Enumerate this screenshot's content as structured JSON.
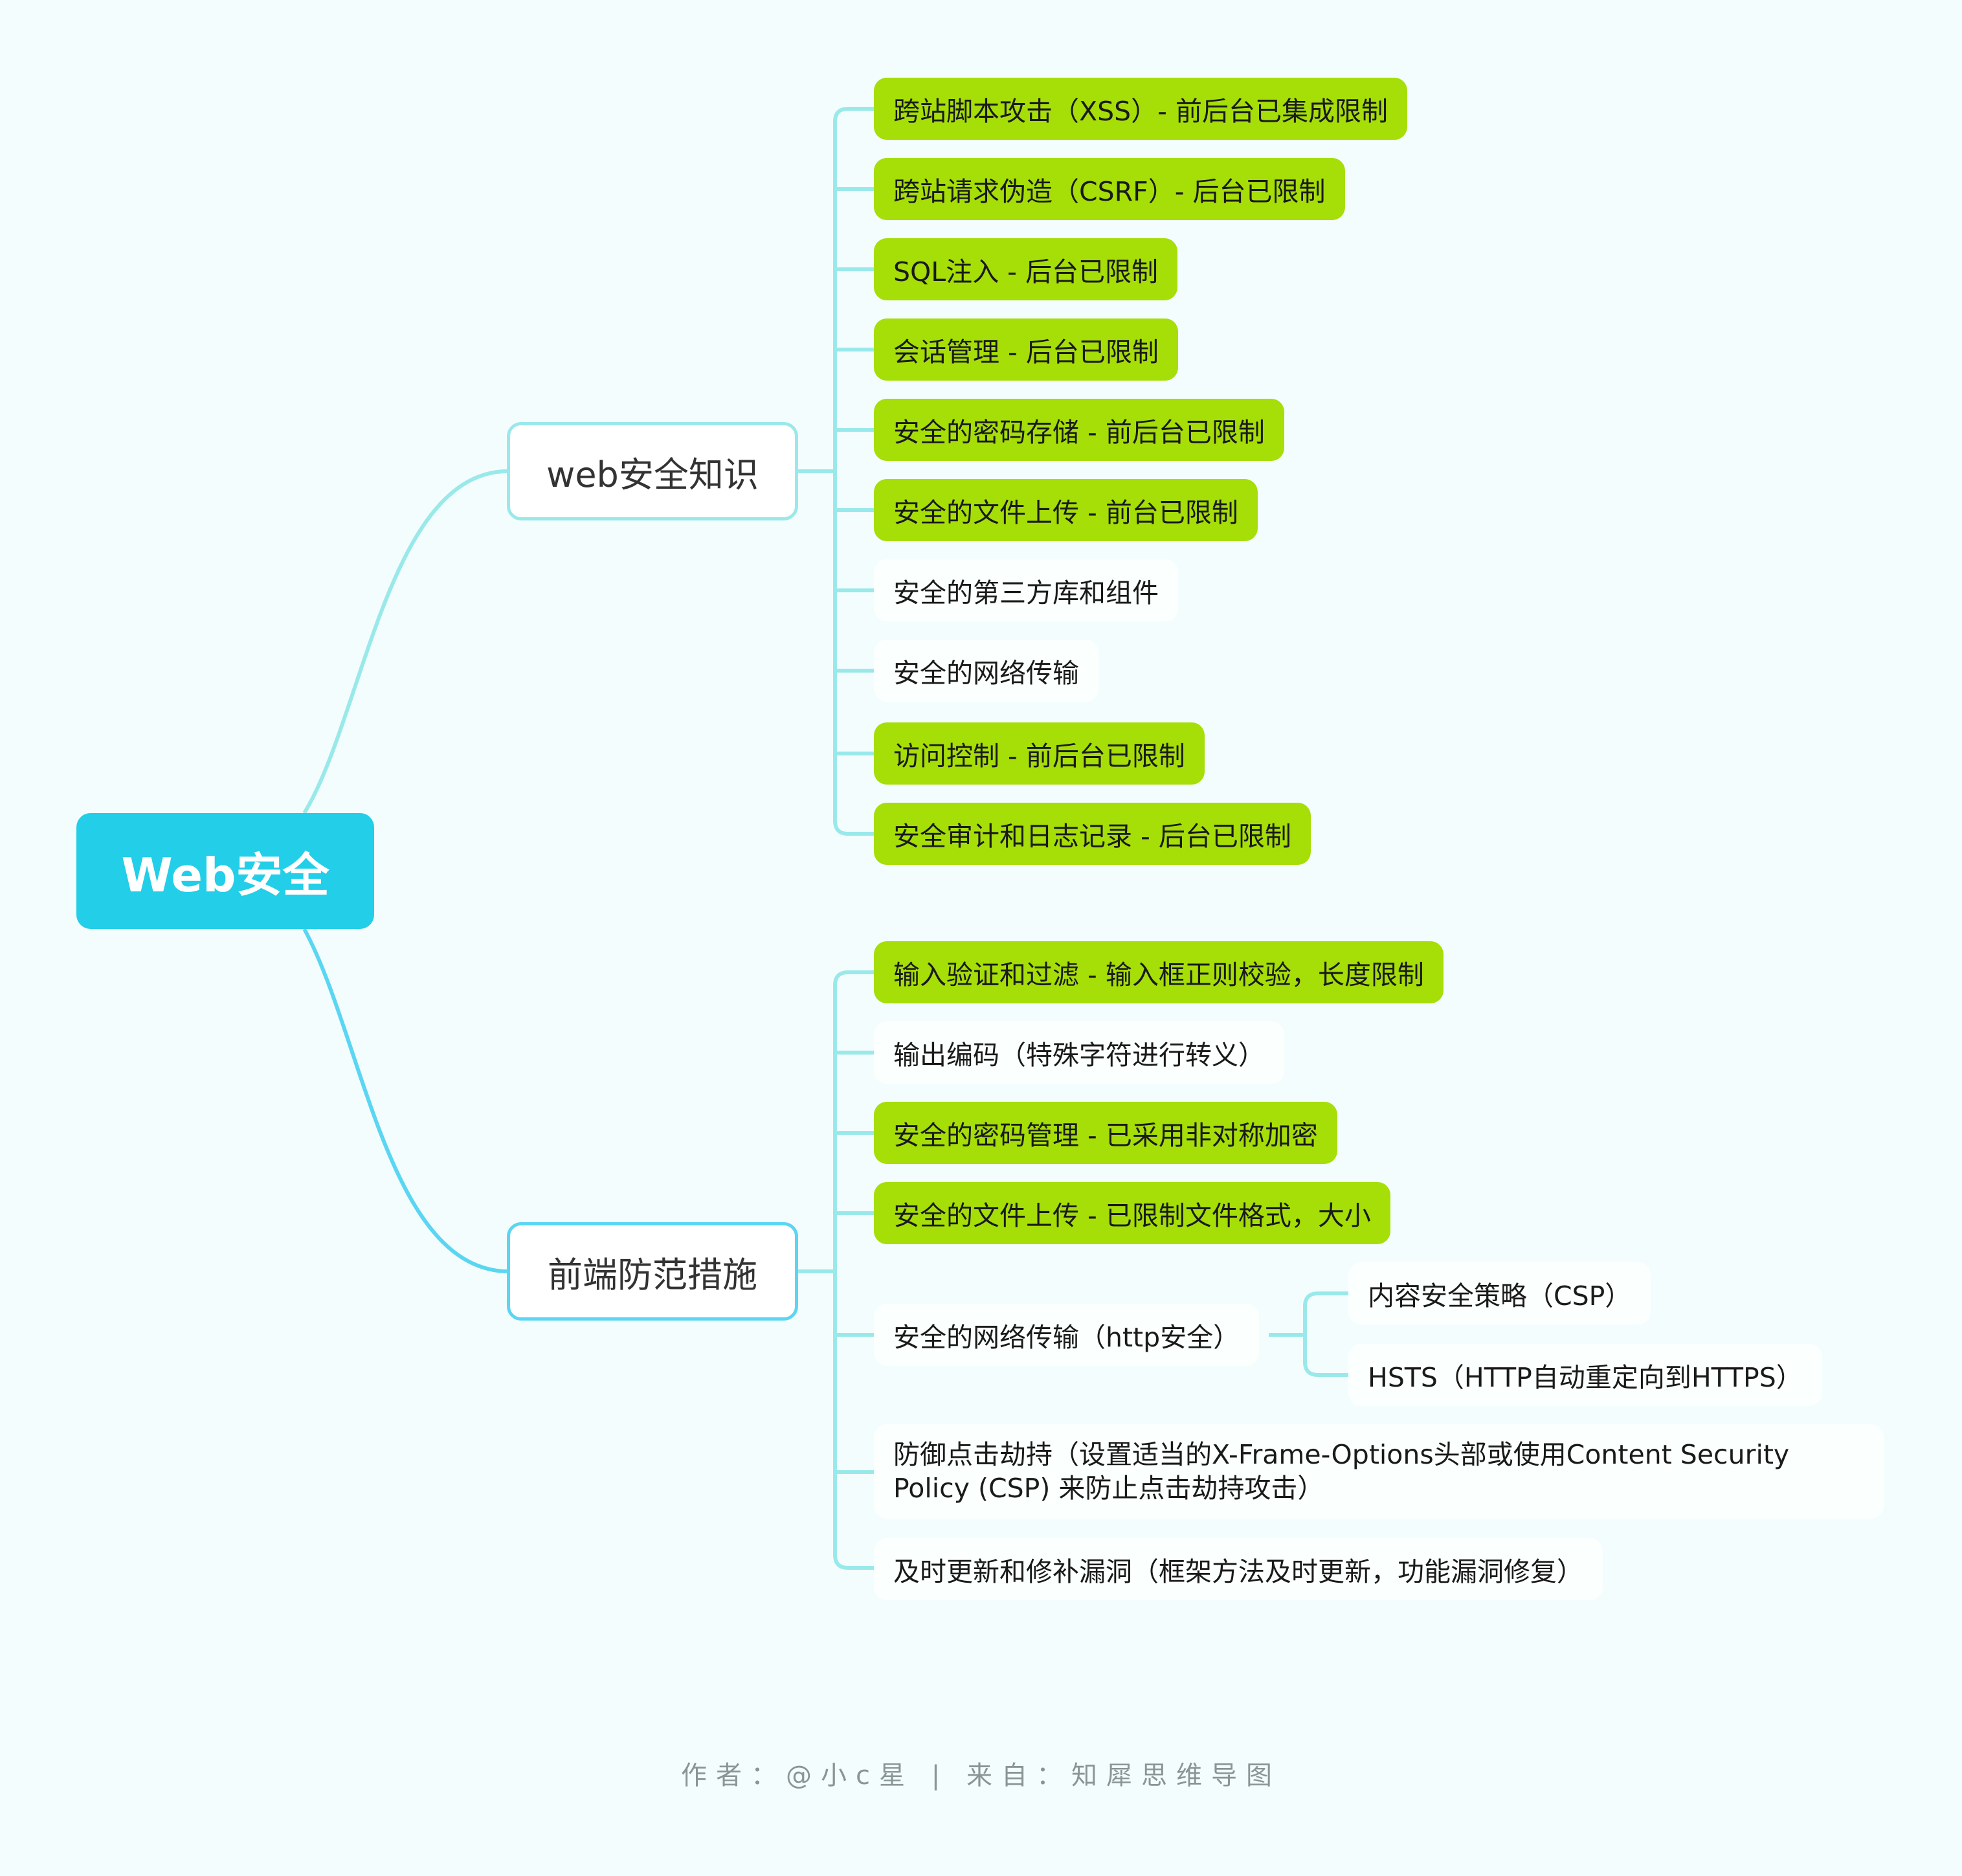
{
  "colors": {
    "background": "#f4fdfd",
    "root": "#22cee8",
    "green": "#a6de08",
    "branch1_line": "#9ae9ea",
    "branch2_line": "#5bd6f2"
  },
  "root": {
    "label": "Web安全"
  },
  "branch1": {
    "label": "web安全知识",
    "items": [
      {
        "label": "跨站脚本攻击（XSS）- 前后台已集成限制",
        "style": "green"
      },
      {
        "label": "跨站请求伪造（CSRF）- 后台已限制",
        "style": "green"
      },
      {
        "label": "SQL注入 - 后台已限制",
        "style": "green"
      },
      {
        "label": "会话管理 - 后台已限制",
        "style": "green"
      },
      {
        "label": "安全的密码存储 - 前后台已限制",
        "style": "green"
      },
      {
        "label": "安全的文件上传 - 前台已限制",
        "style": "green"
      },
      {
        "label": "安全的第三方库和组件",
        "style": "white"
      },
      {
        "label": "安全的网络传输",
        "style": "white"
      },
      {
        "label": "访问控制 - 前后台已限制",
        "style": "green"
      },
      {
        "label": "安全审计和日志记录 - 后台已限制",
        "style": "green"
      }
    ]
  },
  "branch2": {
    "label": "前端防范措施",
    "items": [
      {
        "label": "输入验证和过滤 - 输入框正则校验，长度限制",
        "style": "green"
      },
      {
        "label": "输出编码（特殊字符进行转义）",
        "style": "white"
      },
      {
        "label": "安全的密码管理 - 已采用非对称加密",
        "style": "green"
      },
      {
        "label": "安全的文件上传 - 已限制文件格式，大小",
        "style": "green"
      },
      {
        "label": "安全的网络传输（http安全）",
        "style": "white"
      },
      {
        "label": "防御点击劫持（设置适当的X-Frame-Options头部或使用Content Security Policy (CSP) 来防止点击劫持攻击）",
        "style": "white"
      },
      {
        "label": "及时更新和修补漏洞（框架方法及时更新，功能漏洞修复）",
        "style": "white"
      }
    ],
    "network_children": [
      {
        "label": "内容安全策略（CSP）"
      },
      {
        "label": "HSTS（HTTP自动重定向到HTTPS）"
      }
    ]
  },
  "footer": "作者：@小c星 | 来自：知犀思维导图"
}
